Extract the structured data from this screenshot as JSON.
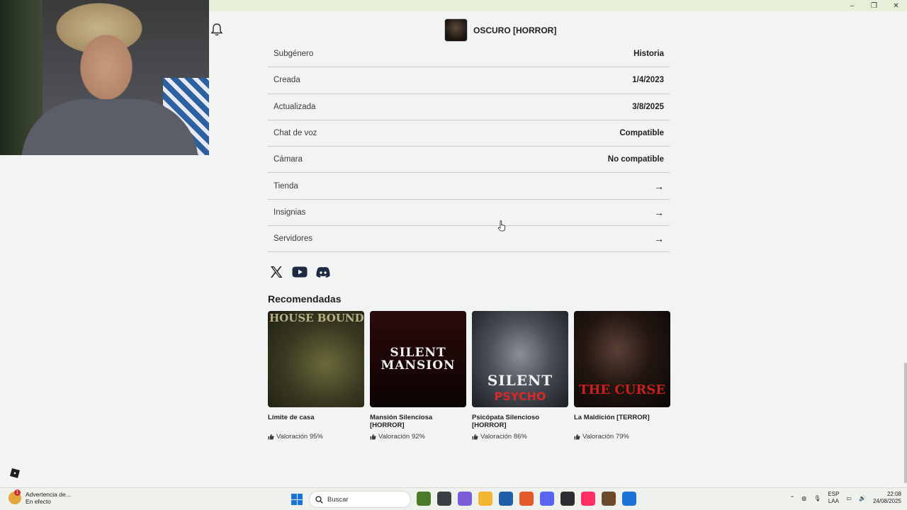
{
  "window": {
    "minimize": "–",
    "restore": "❐",
    "close": "✕"
  },
  "header": {
    "game_title": "OSCURO [HORROR]"
  },
  "details": [
    {
      "label": "Subgénero",
      "value": "Historia"
    },
    {
      "label": "Creada",
      "value": "1/4/2023"
    },
    {
      "label": "Actualizada",
      "value": "3/8/2025"
    },
    {
      "label": "Chat de voz",
      "value": "Compatible"
    },
    {
      "label": "Cámara",
      "value": "No compatible"
    },
    {
      "label": "Tienda",
      "value": "→"
    },
    {
      "label": "Insignias",
      "value": "→"
    },
    {
      "label": "Servidores",
      "value": "→"
    }
  ],
  "social": [
    "x-icon",
    "youtube-icon",
    "discord-icon"
  ],
  "recommended": {
    "title": "Recomendadas",
    "cards": [
      {
        "name": "Límite de casa",
        "rating": "Valoración 95%",
        "thumb_text": "HOUSE BOUND"
      },
      {
        "name": "Mansión Silenciosa [HORROR]",
        "rating": "Valoración 92%",
        "thumb_text": "SILENT MANSION"
      },
      {
        "name": "Psicópata Silencioso [HORROR]",
        "rating": "Valoración 86%",
        "thumb_text": "SILENT",
        "thumb_sub": "PSYCHO"
      },
      {
        "name": "La Maldición [TERROR]",
        "rating": "Valoración 79%",
        "thumb_text": "THE CURSE"
      }
    ]
  },
  "taskbar": {
    "notification_title": "Advertencia de...",
    "notification_sub": "En efecto",
    "notification_count": "1",
    "search_label": "Buscar",
    "lang_top": "ESP",
    "lang_bottom": "LAA",
    "time": "22:08",
    "date": "24/08/2025",
    "app_colors": [
      "#4a7a2a",
      "#3a3f44",
      "#7b5cd6",
      "#f2b530",
      "#1f5fa8",
      "#e35a2a",
      "#5865f2",
      "#2b2d31",
      "#ff2e63",
      "#6b4a2a",
      "#1a73d8"
    ]
  }
}
